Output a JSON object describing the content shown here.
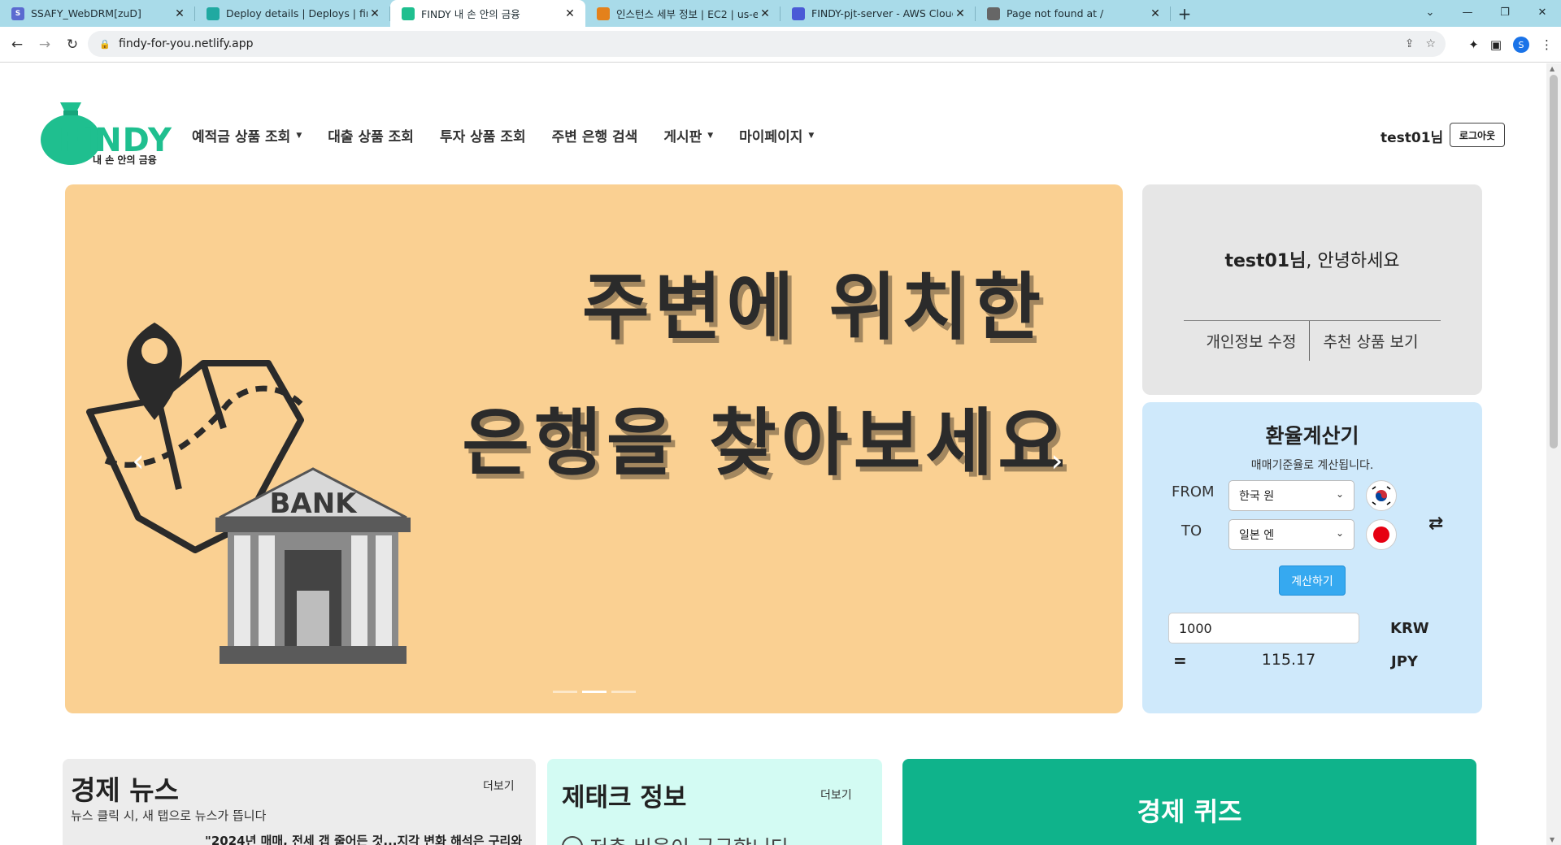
{
  "browser": {
    "tabs": [
      {
        "title": "SSAFY_WebDRM[zuD]",
        "favicon_color": "#5b6ad0",
        "favicon_letter": "S",
        "active": false
      },
      {
        "title": "Deploy details | Deploys | findy",
        "favicon_color": "#20a9a1",
        "favicon_letter": "",
        "active": false
      },
      {
        "title": "FINDY 내 손 안의 금융",
        "favicon_color": "#1fbf8f",
        "favicon_letter": "",
        "active": true
      },
      {
        "title": "인스턴스 세부 정보 | EC2 | us-e",
        "favicon_color": "#e4811b",
        "favicon_letter": "",
        "active": false
      },
      {
        "title": "FINDY-pjt-server - AWS Cloud",
        "favicon_color": "#4a5ad6",
        "favicon_letter": "",
        "active": false
      },
      {
        "title": "Page not found at /",
        "favicon_color": "#666666",
        "favicon_letter": "",
        "active": false
      }
    ],
    "url": "findy-for-you.netlify.app",
    "profile_initial": "S"
  },
  "header": {
    "logo_word": "FINDY",
    "logo_tagline": "내 손 안의 금융",
    "nav": [
      {
        "label": "예적금 상품 조회",
        "dropdown": true
      },
      {
        "label": "대출 상품 조회",
        "dropdown": false
      },
      {
        "label": "투자 상품 조회",
        "dropdown": false
      },
      {
        "label": "주변 은행 검색",
        "dropdown": false
      },
      {
        "label": "게시판",
        "dropdown": true
      },
      {
        "label": "마이페이지",
        "dropdown": true
      }
    ],
    "user_name": "test01님",
    "logout_label": "로그아웃"
  },
  "banner": {
    "line1": "주변에 위치한",
    "line2": "은행을 찾아보세요",
    "bank_sign": "BANK",
    "slide_count": 3,
    "active_slide": 2,
    "bg_color": "#fad092"
  },
  "greeting": {
    "user": "test01님",
    "suffix": ", 안녕하세요",
    "link_edit": "개인정보 수정",
    "link_recommend": "추천 상품 보기"
  },
  "exchange": {
    "title": "환율계산기",
    "subtitle": "매매기준율로 계산됩니다.",
    "from_label": "FROM",
    "to_label": "TO",
    "from_currency": "한국 원",
    "to_currency": "일본 엔",
    "calc_label": "계산하기",
    "amount": "1000",
    "from_code": "KRW",
    "equals": "=",
    "result": "115.17",
    "to_code": "JPY"
  },
  "cards": {
    "news_title": "경제 뉴스",
    "news_more": "더보기",
    "news_hint": "뉴스 클릭 시, 새 탭으로 뉴스가 뜹니다",
    "news_peek": "\"2024년 매매, 전세 갭 줄어든 것...지각 변화 해석은 구리와",
    "tech_title": "제태크 정보",
    "tech_more": "더보기",
    "tech_peek": "저축 비율이 궁금합니다",
    "quiz_title": "경제 퀴즈"
  }
}
